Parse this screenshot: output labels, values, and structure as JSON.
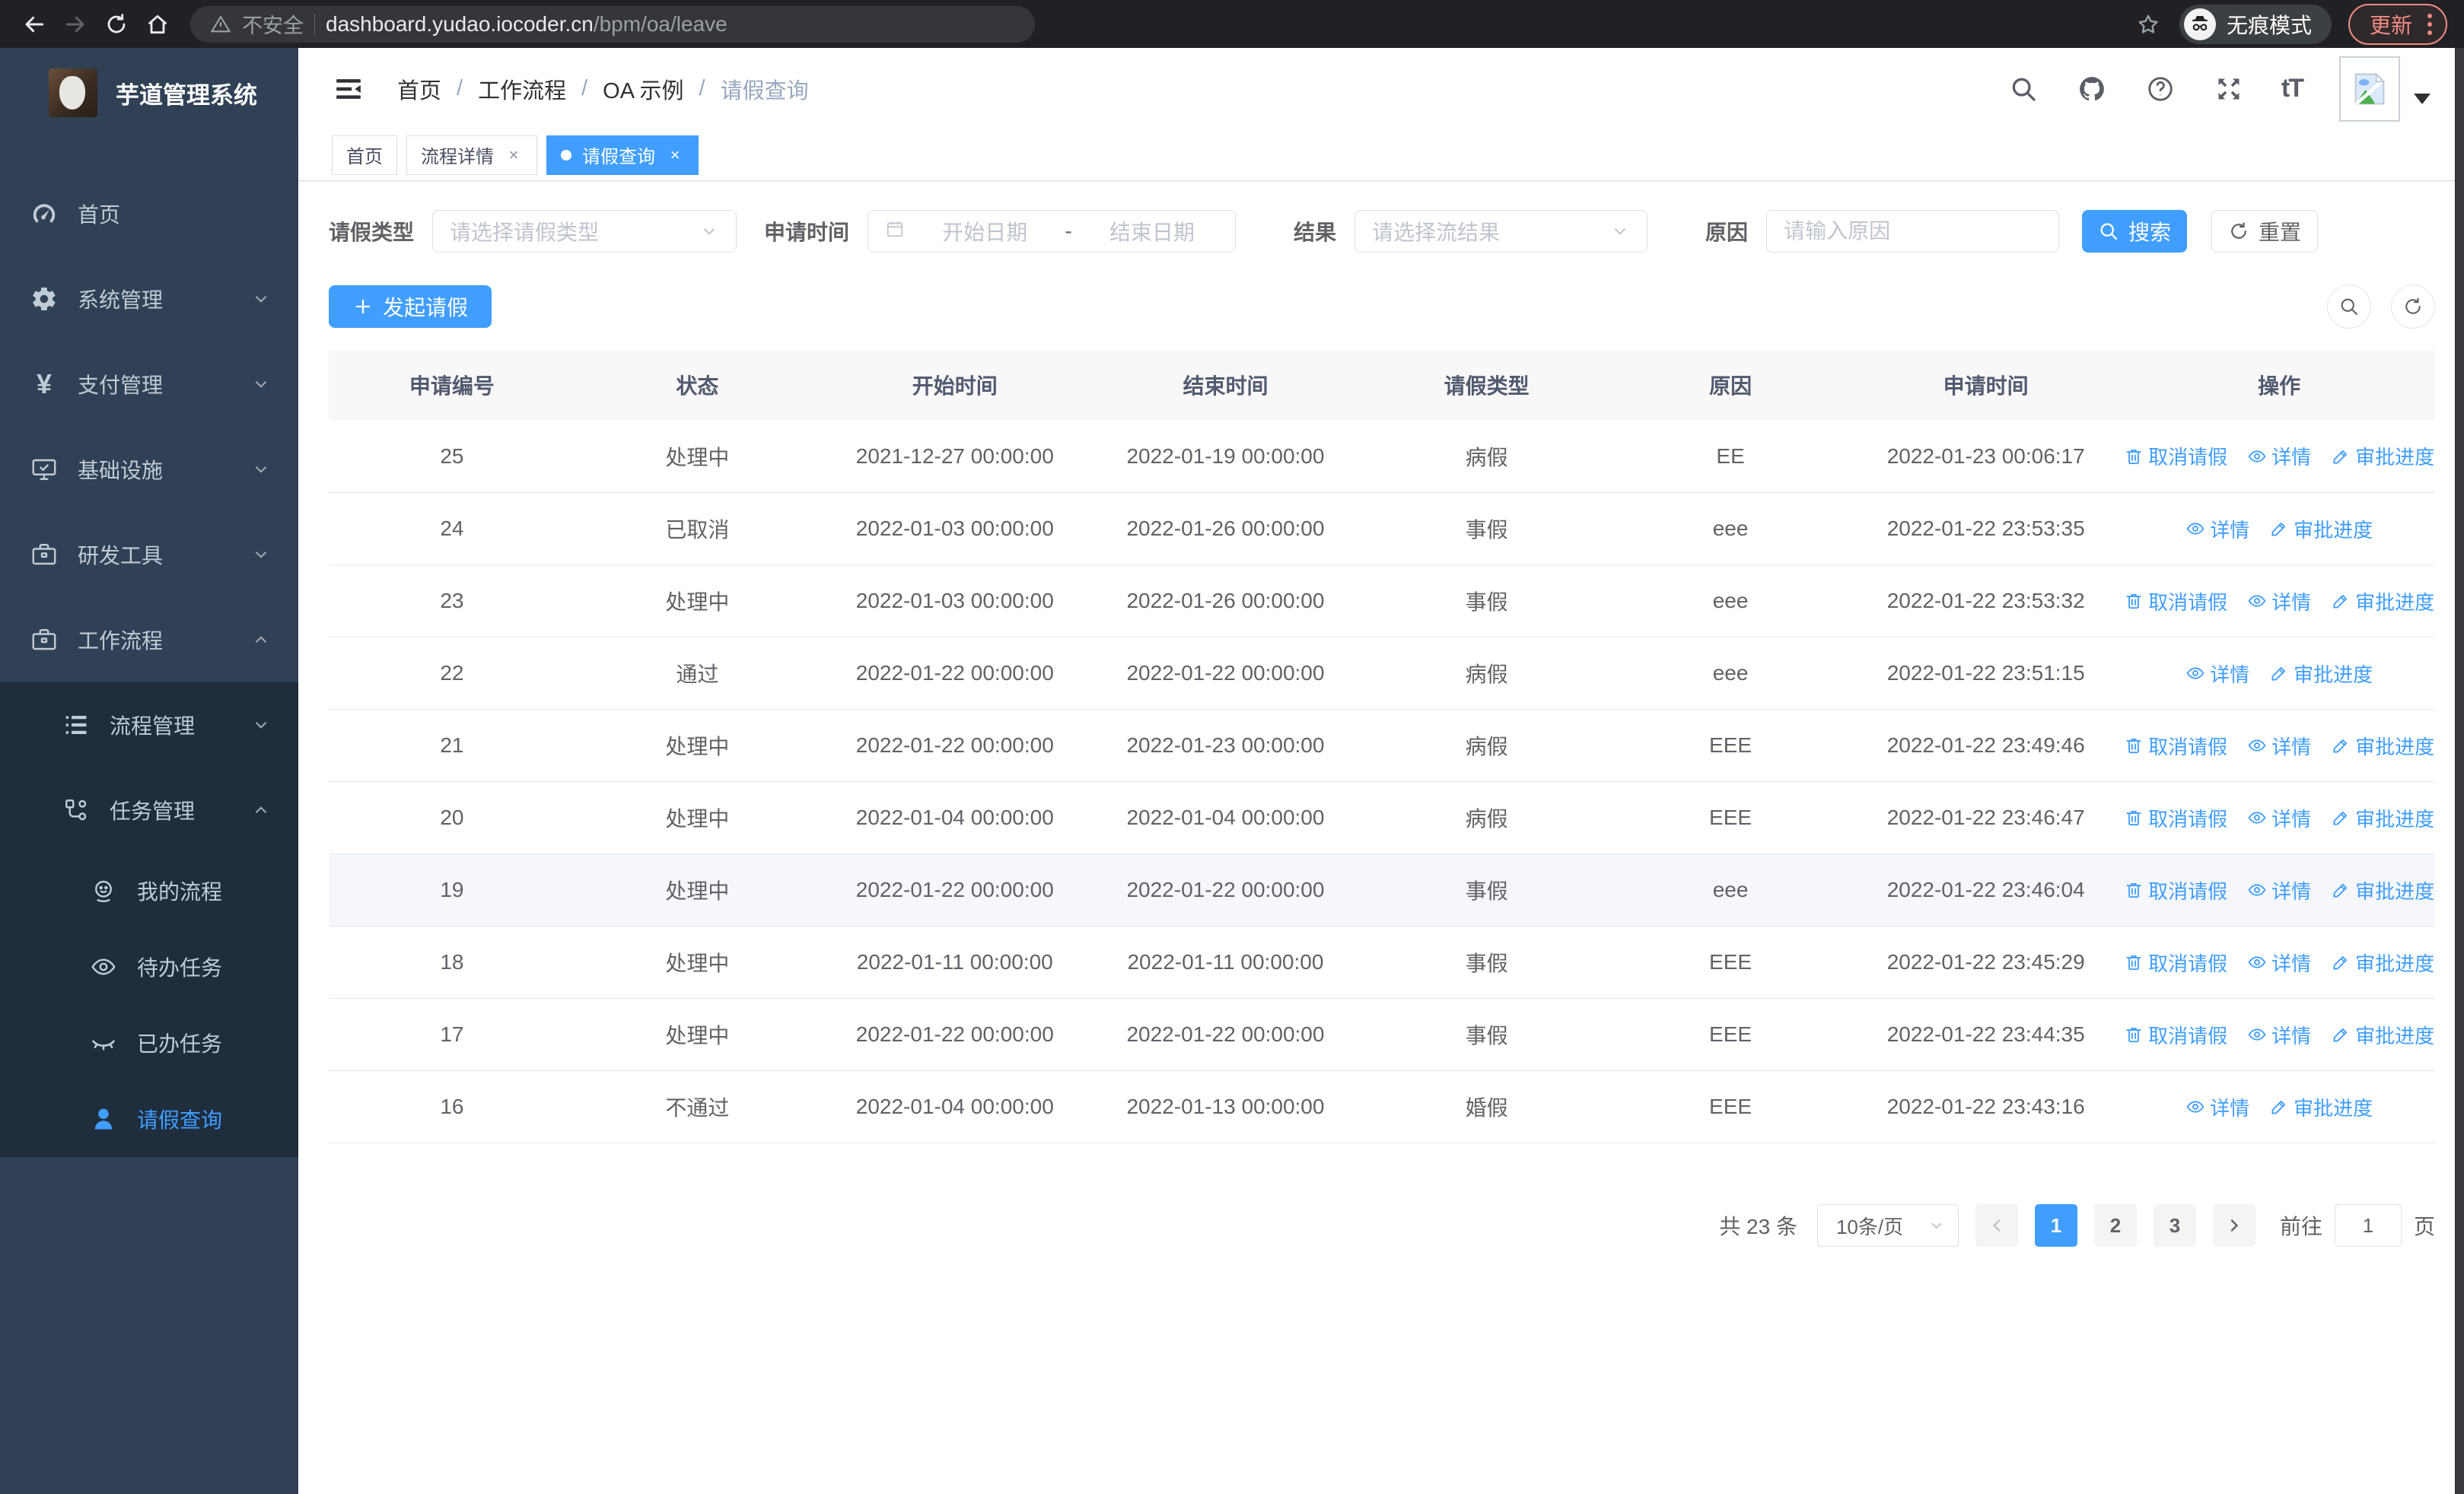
{
  "colors": {
    "accent": "#409eff",
    "sidebar_bg": "#304156",
    "submenu_bg": "#1f2d3d",
    "update_red": "#f28b82"
  },
  "browser": {
    "security_label": "不安全",
    "url_host": "dashboard.yudao.iocoder.cn",
    "url_path": "/bpm/oa/leave",
    "incognito_label": "无痕模式",
    "update_label": "更新"
  },
  "sidebar": {
    "title": "芋道管理系统",
    "items": [
      {
        "label": "首页"
      },
      {
        "label": "系统管理"
      },
      {
        "label": "支付管理"
      },
      {
        "label": "基础设施"
      },
      {
        "label": "研发工具"
      },
      {
        "label": "工作流程"
      },
      {
        "label": "流程管理"
      },
      {
        "label": "任务管理"
      },
      {
        "label": "我的流程"
      },
      {
        "label": "待办任务"
      },
      {
        "label": "已办任务"
      },
      {
        "label": "请假查询"
      }
    ]
  },
  "header": {
    "breadcrumb": [
      "首页",
      "工作流程",
      "OA 示例",
      "请假查询"
    ]
  },
  "tabs": [
    {
      "label": "首页"
    },
    {
      "label": "流程详情"
    },
    {
      "label": "请假查询"
    }
  ],
  "filters": {
    "leave_type_label": "请假类型",
    "leave_type_placeholder": "请选择请假类型",
    "apply_time_label": "申请时间",
    "start_date_placeholder": "开始日期",
    "date_separator": "-",
    "end_date_placeholder": "结束日期",
    "result_label": "结果",
    "result_placeholder": "请选择流结果",
    "reason_label": "原因",
    "reason_placeholder": "请输入原因",
    "search_label": "搜索",
    "reset_label": "重置"
  },
  "toolbar": {
    "create_label": "发起请假"
  },
  "table": {
    "columns": [
      "申请编号",
      "状态",
      "开始时间",
      "结束时间",
      "请假类型",
      "原因",
      "申请时间",
      "操作"
    ],
    "action_labels": {
      "cancel": "取消请假",
      "detail": "详情",
      "progress": "审批进度"
    },
    "rows": [
      {
        "id": "25",
        "status": "处理中",
        "start": "2021-12-27 00:00:00",
        "end": "2022-01-19 00:00:00",
        "type": "病假",
        "reason": "EE",
        "apply_time": "2022-01-23 00:06:17",
        "cancelable": true,
        "highlight": false
      },
      {
        "id": "24",
        "status": "已取消",
        "start": "2022-01-03 00:00:00",
        "end": "2022-01-26 00:00:00",
        "type": "事假",
        "reason": "eee",
        "apply_time": "2022-01-22 23:53:35",
        "cancelable": false,
        "highlight": false
      },
      {
        "id": "23",
        "status": "处理中",
        "start": "2022-01-03 00:00:00",
        "end": "2022-01-26 00:00:00",
        "type": "事假",
        "reason": "eee",
        "apply_time": "2022-01-22 23:53:32",
        "cancelable": true,
        "highlight": false
      },
      {
        "id": "22",
        "status": "通过",
        "start": "2022-01-22 00:00:00",
        "end": "2022-01-22 00:00:00",
        "type": "病假",
        "reason": "eee",
        "apply_time": "2022-01-22 23:51:15",
        "cancelable": false,
        "highlight": false
      },
      {
        "id": "21",
        "status": "处理中",
        "start": "2022-01-22 00:00:00",
        "end": "2022-01-23 00:00:00",
        "type": "病假",
        "reason": "EEE",
        "apply_time": "2022-01-22 23:49:46",
        "cancelable": true,
        "highlight": false
      },
      {
        "id": "20",
        "status": "处理中",
        "start": "2022-01-04 00:00:00",
        "end": "2022-01-04 00:00:00",
        "type": "病假",
        "reason": "EEE",
        "apply_time": "2022-01-22 23:46:47",
        "cancelable": true,
        "highlight": false
      },
      {
        "id": "19",
        "status": "处理中",
        "start": "2022-01-22 00:00:00",
        "end": "2022-01-22 00:00:00",
        "type": "事假",
        "reason": "eee",
        "apply_time": "2022-01-22 23:46:04",
        "cancelable": true,
        "highlight": true
      },
      {
        "id": "18",
        "status": "处理中",
        "start": "2022-01-11 00:00:00",
        "end": "2022-01-11 00:00:00",
        "type": "事假",
        "reason": "EEE",
        "apply_time": "2022-01-22 23:45:29",
        "cancelable": true,
        "highlight": false
      },
      {
        "id": "17",
        "status": "处理中",
        "start": "2022-01-22 00:00:00",
        "end": "2022-01-22 00:00:00",
        "type": "事假",
        "reason": "EEE",
        "apply_time": "2022-01-22 23:44:35",
        "cancelable": true,
        "highlight": false
      },
      {
        "id": "16",
        "status": "不通过",
        "start": "2022-01-04 00:00:00",
        "end": "2022-01-13 00:00:00",
        "type": "婚假",
        "reason": "EEE",
        "apply_time": "2022-01-22 23:43:16",
        "cancelable": false,
        "highlight": false
      }
    ]
  },
  "pagination": {
    "total_label": "共 23 条",
    "page_size_label": "10条/页",
    "pages": [
      "1",
      "2",
      "3"
    ],
    "active_page": "1",
    "goto_label": "前往",
    "goto_value": "1",
    "page_unit": "页"
  }
}
